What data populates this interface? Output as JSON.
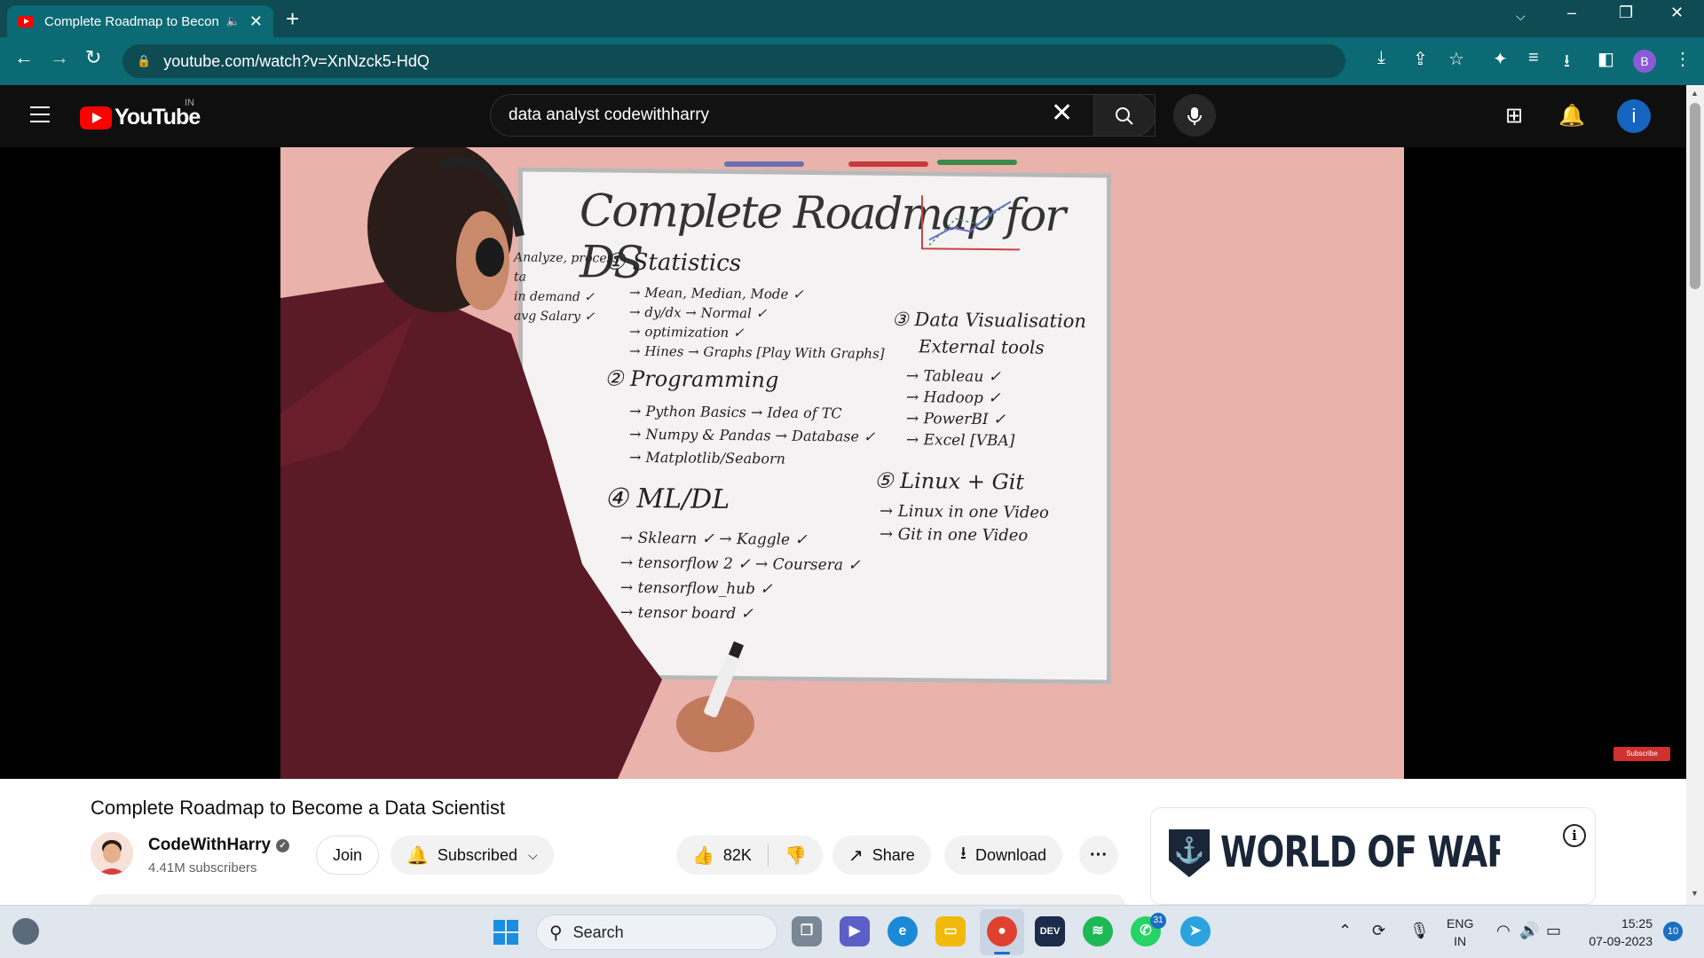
{
  "browser": {
    "tab_title": "Complete Roadmap to Becon",
    "new_tab": "+",
    "url": "youtube.com/watch?v=XnNzck5-HdQ",
    "profile_initial": "B"
  },
  "youtube": {
    "logo_word": "YouTube",
    "region": "IN",
    "search_query": "data analyst codewithharry",
    "avatar_initial": "i"
  },
  "video_frame": {
    "board_title": "Complete Roadmap for DS",
    "left_notes": [
      "Analyze, process",
      "ta",
      "in demand ✓",
      "avg Salary ✓"
    ],
    "stats_heading": "① Statistics",
    "stats_items": [
      "→ Mean, Median, Mode ✓",
      "→ dy/dx  → Normal ✓",
      "→ optimization ✓",
      "→ Hines  → Graphs [Play With Graphs]"
    ],
    "prog_heading": "② Programming",
    "prog_items": [
      "→ Python Basics → Idea of TC",
      "→ Numpy & Pandas → Database ✓",
      "→ Matplotlib/Seaborn"
    ],
    "ml_heading": "④ ML/DL",
    "ml_items": [
      "→ Sklearn ✓  → Kaggle ✓",
      "→ tensorflow 2 ✓ → Coursera ✓",
      "→ tensorflow_hub ✓",
      "→ tensor board ✓"
    ],
    "viz_heading": "③ Data Visualisation",
    "viz_sub": "External tools",
    "viz_items": [
      "→ Tableau ✓",
      "→ Hadoop ✓",
      "→ PowerBI ✓",
      "→ Excel [VBA]"
    ],
    "linux_heading": "⑤ Linux + Git",
    "linux_items": [
      "→ Linux in one Video",
      "→ Git in one Video"
    ],
    "subscribe_watermark": "Subscribe"
  },
  "watch": {
    "title": "Complete Roadmap to Become a Data Scientist",
    "channel_name": "CodeWithHarry",
    "subscribers": "4.41M subscribers",
    "join_label": "Join",
    "subscribed_label": "Subscribed",
    "like_count": "82K",
    "share_label": "Share",
    "download_label": "Download",
    "ad_text": "WORLD OF WARSHIPS"
  },
  "taskbar": {
    "search_label": "Search",
    "whatsapp_badge": "31",
    "lang_line1": "ENG",
    "lang_line2": "IN",
    "time": "15:25",
    "date": "07-09-2023",
    "notifications": "10"
  }
}
